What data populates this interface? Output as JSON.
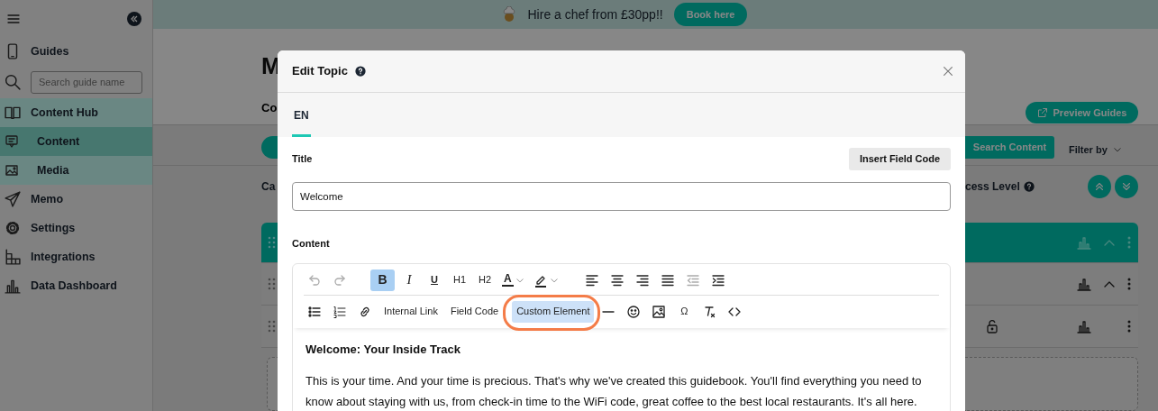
{
  "sidebar": {
    "items": [
      {
        "kind": "link",
        "label": "Guides",
        "selected": false,
        "expanded": false
      },
      {
        "kind": "search",
        "placeholder": "Search guide name"
      },
      {
        "kind": "link",
        "label": "Content Hub",
        "selected": false,
        "expanded": true,
        "children": [
          {
            "label": "Content",
            "selected": true
          },
          {
            "label": "Media",
            "selected": false
          }
        ]
      },
      {
        "kind": "link",
        "label": "Memo",
        "selected": false,
        "expanded": false
      },
      {
        "kind": "link",
        "label": "Settings",
        "selected": false,
        "expanded": false
      },
      {
        "kind": "link",
        "label": "Integrations",
        "selected": false,
        "expanded": false
      },
      {
        "kind": "link",
        "label": "Data Dashboard",
        "selected": false,
        "expanded": false
      }
    ]
  },
  "banner": {
    "text": "Hire a chef from £30pp!!",
    "button": "Book here"
  },
  "page": {
    "title": "M",
    "tabs": [
      {
        "label": "Co",
        "selected": true
      }
    ],
    "preview_button": "Preview Guides",
    "search_button": "Search Content",
    "filter": "Filter by",
    "column_1": "Ca",
    "column_2": "cess Level",
    "rows": [
      {
        "selected": true,
        "expanded": true,
        "locked": false
      },
      {
        "selected": false,
        "expanded": true,
        "locked": false
      },
      {
        "selected": false,
        "expanded": false,
        "locked": true
      }
    ]
  },
  "modal": {
    "title": "Edit Topic",
    "tabs": [
      {
        "label": "EN",
        "selected": true
      }
    ],
    "title_label": "Title",
    "insert_button": "Insert Field Code",
    "title_value": "Welcome",
    "content_label": "Content",
    "toolbar": [
      [
        [
          {
            "kind": "undo",
            "active": false,
            "disabled": true
          },
          {
            "kind": "redo",
            "active": false,
            "disabled": true
          }
        ],
        [
          {
            "kind": "bold",
            "label": "B",
            "active": true,
            "disabled": false
          },
          {
            "kind": "italic",
            "label": "I",
            "active": false,
            "disabled": false
          },
          {
            "kind": "underline",
            "label": "U",
            "active": false,
            "disabled": false
          },
          {
            "kind": "text",
            "label": "H1",
            "active": false,
            "disabled": false
          },
          {
            "kind": "text",
            "label": "H2",
            "active": false,
            "disabled": false
          },
          {
            "kind": "textcolor",
            "label": "A",
            "active": false,
            "disabled": false
          },
          {
            "kind": "highlight",
            "active": false,
            "disabled": false
          }
        ],
        [
          {
            "kind": "align-left",
            "active": false,
            "disabled": false
          },
          {
            "kind": "align-center",
            "active": false,
            "disabled": false
          },
          {
            "kind": "align-right",
            "active": false,
            "disabled": false
          },
          {
            "kind": "justify",
            "active": false,
            "disabled": false
          },
          {
            "kind": "outdent",
            "active": false,
            "disabled": true
          },
          {
            "kind": "indent",
            "active": false,
            "disabled": false
          }
        ]
      ],
      [
        [
          {
            "kind": "bullet-list",
            "active": false,
            "disabled": false
          },
          {
            "kind": "numbered-list",
            "active": false,
            "disabled": false
          },
          {
            "kind": "link",
            "active": false,
            "disabled": false
          },
          {
            "kind": "text",
            "label": "Internal Link",
            "active": false,
            "disabled": false,
            "circled": false
          },
          {
            "kind": "text",
            "label": "Field Code",
            "active": false,
            "disabled": false,
            "circled": false
          },
          {
            "kind": "text",
            "label": "Custom Element",
            "active": true,
            "disabled": false,
            "circled": true
          },
          {
            "kind": "hr",
            "active": false,
            "disabled": false
          },
          {
            "kind": "emoji",
            "active": false,
            "disabled": false
          },
          {
            "kind": "image",
            "active": false,
            "disabled": false
          },
          {
            "kind": "text",
            "label": "Ω",
            "active": false,
            "disabled": false,
            "circled": false
          },
          {
            "kind": "clear-format",
            "active": false,
            "disabled": false
          },
          {
            "kind": "code",
            "active": false,
            "disabled": false
          }
        ]
      ]
    ],
    "heading": "Welcome: Your Inside Track",
    "paragraph": "This is your time. And your time is precious. That's why we've created this guidebook. You'll find everything you need to know about staying with us, from check-in time to the WiFi code, great coffee to the best local restaurants. It's all here."
  }
}
